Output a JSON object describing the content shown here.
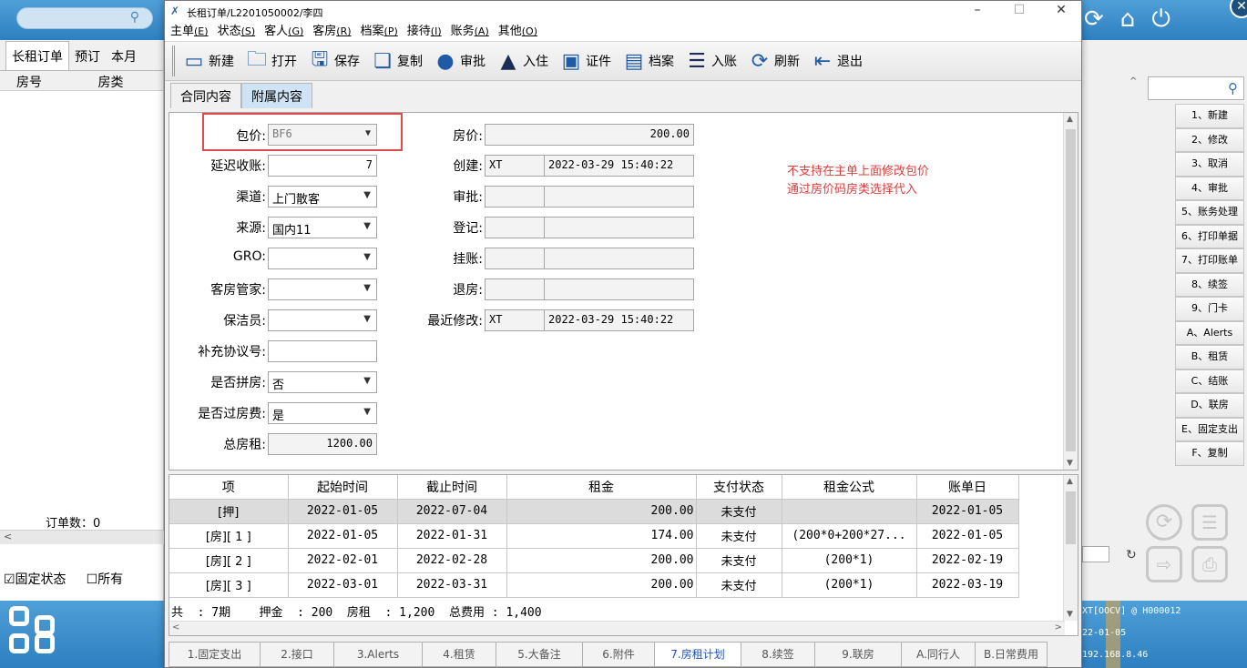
{
  "bg": {
    "left_tabs": [
      "长租订单",
      "预订",
      "本月"
    ],
    "left_cols": [
      "房号",
      "房类"
    ],
    "order_count_label": "订单数：0",
    "fixed_status": "☑固定状态",
    "all": "☐所有",
    "right_list": [
      "1、新建",
      "2、修改",
      "3、取消",
      "4、审批",
      "5、账务处理",
      "6、打印单据",
      "7、打印账单",
      "8、续签",
      "9、门卡",
      "A、Alerts",
      "B、租赁",
      "C、结账",
      "D、联房",
      "E、固定支出",
      "F、复制"
    ],
    "status_lines": [
      "XT[OOCV] @ H000012",
      "22-01-05",
      "192.168.8.46"
    ]
  },
  "window": {
    "title": "长租订单/L2201050002/李四",
    "controls": [
      "–",
      "☐",
      "✕"
    ]
  },
  "menu": [
    {
      "label": "主单",
      "key": "(E)"
    },
    {
      "label": "状态",
      "key": "(S)"
    },
    {
      "label": "客人",
      "key": "(G)"
    },
    {
      "label": "客房",
      "key": "(R)"
    },
    {
      "label": "档案",
      "key": "(P)"
    },
    {
      "label": "接待",
      "key": "(I)"
    },
    {
      "label": "账务",
      "key": "(A)"
    },
    {
      "label": "其他",
      "key": "(O)"
    }
  ],
  "toolbar": [
    {
      "label": "新建",
      "icon": "new-icon"
    },
    {
      "label": "打开",
      "icon": "open-icon"
    },
    {
      "label": "保存",
      "icon": "save-icon"
    },
    {
      "label": "复制",
      "icon": "copy-icon"
    },
    {
      "label": "审批",
      "icon": "approve-icon"
    },
    {
      "label": "入住",
      "icon": "checkin-icon"
    },
    {
      "label": "证件",
      "icon": "id-icon"
    },
    {
      "label": "档案",
      "icon": "profile-icon"
    },
    {
      "label": "入账",
      "icon": "post-icon"
    },
    {
      "label": "刷新",
      "icon": "refresh-icon"
    },
    {
      "label": "退出",
      "icon": "exit-icon"
    }
  ],
  "subtabs": [
    "合同内容",
    "附属内容"
  ],
  "form": {
    "package_label": "包价:",
    "package_value": "BF6",
    "delay_label": "延迟收账:",
    "delay_value": "7",
    "channel_label": "渠道:",
    "channel_value": "上门散客",
    "source_label": "来源:",
    "source_value": "国内11",
    "gro_label": "GRO:",
    "gro_value": "",
    "housekeeper_label": "客房管家:",
    "housekeeper_value": "",
    "cleaner_label": "保洁员:",
    "cleaner_value": "",
    "supplement_label": "补充协议号:",
    "supplement_value": "",
    "share_label": "是否拼房:",
    "share_value": "否",
    "roomfee_label": "是否过房费:",
    "roomfee_value": "是",
    "total_label": "总房租:",
    "total_value": "1200.00",
    "price_label": "房价:",
    "price_value": "200.00",
    "create_label": "创建:",
    "create_user": "XT",
    "create_time": "2022-03-29 15:40:22",
    "approve_label": "审批:",
    "approve_user": "",
    "approve_time": "",
    "register_label": "登记:",
    "register_user": "",
    "register_time": "",
    "hold_label": "挂账:",
    "hold_user": "",
    "hold_time": "",
    "checkout_label": "退房:",
    "checkout_user": "",
    "checkout_time": "",
    "modified_label": "最近修改:",
    "modified_user": "XT",
    "modified_time": "2022-03-29 15:40:22"
  },
  "note": [
    "不支持在主单上面修改包价",
    "通过房价码房类选择代入"
  ],
  "grid": {
    "headers": [
      "项",
      "起始时间",
      "截止时间",
      "租金",
      "支付状态",
      "租金公式",
      "账单日"
    ],
    "rows": [
      [
        "[押]",
        "2022-01-05",
        "2022-07-04",
        "200.00",
        "未支付",
        "",
        "2022-01-05"
      ],
      [
        "[房][ 1 ]",
        "2022-01-05",
        "2022-01-31",
        "174.00",
        "未支付",
        "(200*0+200*27...",
        "2022-01-05"
      ],
      [
        "[房][ 2 ]",
        "2022-02-01",
        "2022-02-28",
        "200.00",
        "未支付",
        "(200*1)",
        "2022-02-19"
      ],
      [
        "[房][ 3 ]",
        "2022-03-01",
        "2022-03-31",
        "200.00",
        "未支付",
        "(200*1)",
        "2022-03-19"
      ]
    ],
    "summary": "共  : 7期    押金  : 200  房租  : 1,200  总费用 : 1,400"
  },
  "bottom_tabs": [
    "1.固定支出",
    "2.接口",
    "3.Alerts",
    "4.租赁",
    "5.大备注",
    "6.附件",
    "7.房租计划",
    "8.续签",
    "9.联房",
    "A.同行人",
    "B.日常费用"
  ],
  "active_bottom_tab": 6
}
